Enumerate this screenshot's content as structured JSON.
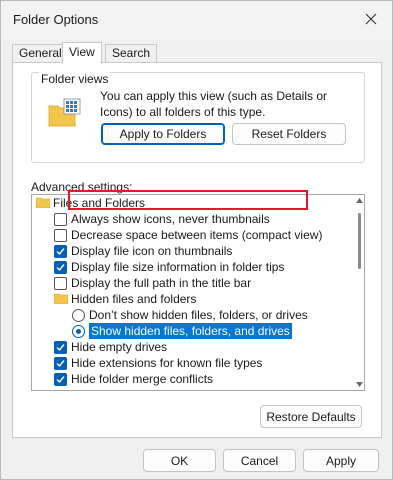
{
  "window": {
    "title": "Folder Options"
  },
  "tabs": [
    {
      "label": "General",
      "active": false
    },
    {
      "label": "View",
      "active": true
    },
    {
      "label": "Search",
      "active": false
    }
  ],
  "folder_views": {
    "label": "Folder views",
    "description": "You can apply this view (such as Details or Icons) to all folders of this type.",
    "apply_label": "Apply to Folders",
    "reset_label": "Reset Folders"
  },
  "advanced": {
    "label": "Advanced settings:",
    "items": [
      {
        "type": "folder",
        "label": "Files and Folders",
        "indent": 0
      },
      {
        "type": "checkbox",
        "label": "Always show icons, never thumbnails",
        "checked": false,
        "indent": 1
      },
      {
        "type": "checkbox",
        "label": "Decrease space between items (compact view)",
        "checked": false,
        "indent": 1
      },
      {
        "type": "checkbox",
        "label": "Display file icon on thumbnails",
        "checked": true,
        "indent": 1
      },
      {
        "type": "checkbox",
        "label": "Display file size information in folder tips",
        "checked": true,
        "indent": 1
      },
      {
        "type": "checkbox",
        "label": "Display the full path in the title bar",
        "checked": false,
        "indent": 1
      },
      {
        "type": "folder",
        "label": "Hidden files and folders",
        "indent": 1
      },
      {
        "type": "radio",
        "label": "Don’t show hidden files, folders, or drives",
        "checked": false,
        "indent": 2
      },
      {
        "type": "radio",
        "label": "Show hidden files, folders, and drives",
        "checked": true,
        "selected": true,
        "indent": 2
      },
      {
        "type": "checkbox",
        "label": "Hide empty drives",
        "checked": true,
        "indent": 1
      },
      {
        "type": "checkbox",
        "label": "Hide extensions for known file types",
        "checked": true,
        "indent": 1
      },
      {
        "type": "checkbox",
        "label": "Hide folder merge conflicts",
        "checked": true,
        "indent": 1
      }
    ],
    "restore_label": "Restore Defaults"
  },
  "footer": {
    "ok_label": "OK",
    "cancel_label": "Cancel",
    "apply_label": "Apply"
  },
  "colors": {
    "accent": "#005fb8",
    "selection": "#0078d7",
    "highlight_box": "#e8182a",
    "folder": "#f3c74b"
  }
}
